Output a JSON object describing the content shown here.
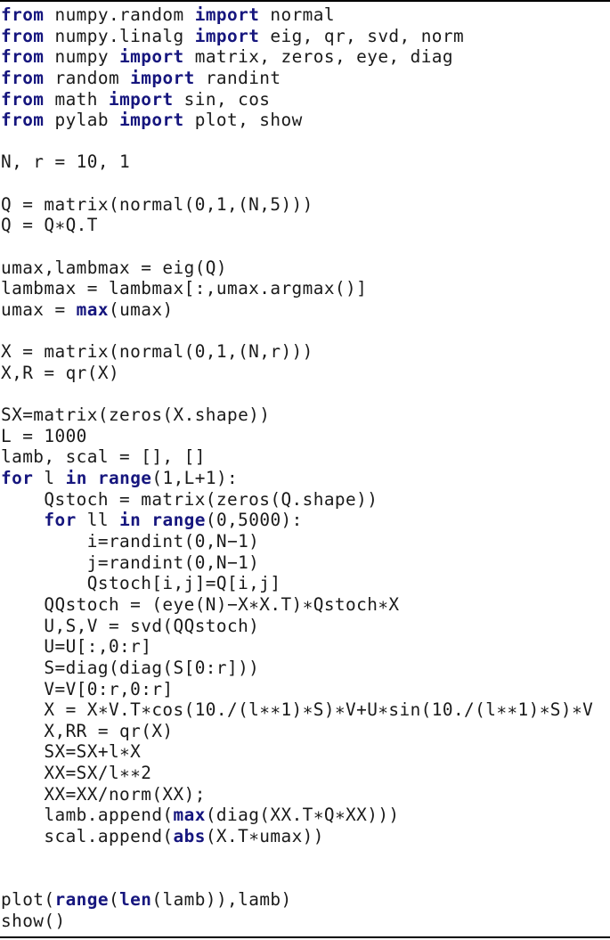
{
  "document": {
    "type": "code-listing",
    "language": "python",
    "keyword_color": "#16167e",
    "text_color": "#1a1a1a",
    "lines": [
      [
        {
          "t": "from",
          "k": true
        },
        {
          "t": " numpy.random "
        },
        {
          "t": "import",
          "k": true
        },
        {
          "t": " normal"
        }
      ],
      [
        {
          "t": "from",
          "k": true
        },
        {
          "t": " numpy.linalg "
        },
        {
          "t": "import",
          "k": true
        },
        {
          "t": " eig, qr, svd, norm"
        }
      ],
      [
        {
          "t": "from",
          "k": true
        },
        {
          "t": " numpy "
        },
        {
          "t": "import",
          "k": true
        },
        {
          "t": " matrix, zeros, eye, diag"
        }
      ],
      [
        {
          "t": "from",
          "k": true
        },
        {
          "t": " random "
        },
        {
          "t": "import",
          "k": true
        },
        {
          "t": " randint"
        }
      ],
      [
        {
          "t": "from",
          "k": true
        },
        {
          "t": " math "
        },
        {
          "t": "import",
          "k": true
        },
        {
          "t": " sin, cos"
        }
      ],
      [
        {
          "t": "from",
          "k": true
        },
        {
          "t": " pylab "
        },
        {
          "t": "import",
          "k": true
        },
        {
          "t": " plot, show"
        }
      ],
      [],
      [
        {
          "t": "N, r = 10, 1"
        }
      ],
      [],
      [
        {
          "t": "Q = matrix(normal(0,1,(N,5)))"
        }
      ],
      [
        {
          "t": "Q = Q∗Q.T"
        }
      ],
      [],
      [
        {
          "t": "umax,lambmax = eig(Q)"
        }
      ],
      [
        {
          "t": "lambmax = lambmax[:,umax.argmax()]"
        }
      ],
      [
        {
          "t": "umax = "
        },
        {
          "t": "max",
          "k": true
        },
        {
          "t": "(umax)"
        }
      ],
      [],
      [
        {
          "t": "X = matrix(normal(0,1,(N,r)))"
        }
      ],
      [
        {
          "t": "X,R = qr(X)"
        }
      ],
      [],
      [
        {
          "t": "SX=matrix(zeros(X.shape))"
        }
      ],
      [
        {
          "t": "L = 1000"
        }
      ],
      [
        {
          "t": "lamb, scal = [], []"
        }
      ],
      [
        {
          "t": "for",
          "k": true
        },
        {
          "t": " l "
        },
        {
          "t": "in",
          "k": true
        },
        {
          "t": " "
        },
        {
          "t": "range",
          "k": true
        },
        {
          "t": "(1,L+1):"
        }
      ],
      [
        {
          "t": "    Qstoch = matrix(zeros(Q.shape))"
        }
      ],
      [
        {
          "t": "    "
        },
        {
          "t": "for",
          "k": true
        },
        {
          "t": " ll "
        },
        {
          "t": "in",
          "k": true
        },
        {
          "t": " "
        },
        {
          "t": "range",
          "k": true
        },
        {
          "t": "(0,5000):"
        }
      ],
      [
        {
          "t": "        i=randint(0,N−1)"
        }
      ],
      [
        {
          "t": "        j=randint(0,N−1)"
        }
      ],
      [
        {
          "t": "        Qstoch[i,j]=Q[i,j]"
        }
      ],
      [
        {
          "t": "    QQstoch = (eye(N)−X∗X.T)∗Qstoch∗X"
        }
      ],
      [
        {
          "t": "    U,S,V = svd(QQstoch)"
        }
      ],
      [
        {
          "t": "    U=U[:,0:r]"
        }
      ],
      [
        {
          "t": "    S=diag(diag(S[0:r]))"
        }
      ],
      [
        {
          "t": "    V=V[0:r,0:r]"
        }
      ],
      [
        {
          "t": "    X = X∗V.T∗cos(10./(l∗∗1)∗S)∗V+U∗sin(10./(l∗∗1)∗S)∗V"
        }
      ],
      [
        {
          "t": "    X,RR = qr(X)"
        }
      ],
      [
        {
          "t": "    SX=SX+l∗X"
        }
      ],
      [
        {
          "t": "    XX=SX/l∗∗2"
        }
      ],
      [
        {
          "t": "    XX=XX/norm(XX);"
        }
      ],
      [
        {
          "t": "    lamb.append("
        },
        {
          "t": "max",
          "k": true
        },
        {
          "t": "(diag(XX.T∗Q∗XX)))"
        }
      ],
      [
        {
          "t": "    scal.append("
        },
        {
          "t": "abs",
          "k": true
        },
        {
          "t": "(X.T∗umax))"
        }
      ],
      [],
      [],
      [
        {
          "t": "plot("
        },
        {
          "t": "range",
          "k": true
        },
        {
          "t": "("
        },
        {
          "t": "len",
          "k": true
        },
        {
          "t": "(lamb)),lamb)"
        }
      ],
      [
        {
          "t": "show()"
        }
      ]
    ]
  }
}
